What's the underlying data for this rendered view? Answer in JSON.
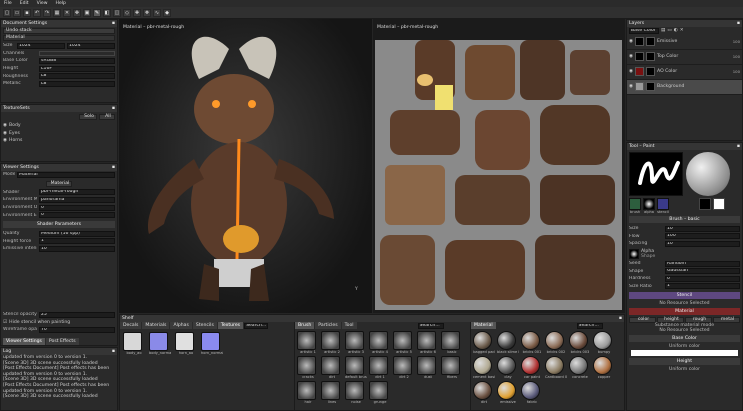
{
  "menu": [
    "File",
    "Edit",
    "View",
    "Help"
  ],
  "document_settings": {
    "title": "Document Settings",
    "undo_stack": "Undo stack",
    "section_material": "Material",
    "size_label": "Size",
    "size_value": "1024",
    "size_value2": "1024",
    "channels_label": "Channels",
    "rows": [
      {
        "label": "Base Color",
        "value": "sRGB8"
      },
      {
        "label": "Height",
        "value": "L16F"
      },
      {
        "label": "Roughness",
        "value": "L8"
      },
      {
        "label": "Metallic",
        "value": "L8"
      }
    ]
  },
  "texture_sets": {
    "title": "TextureSets",
    "solo": "Solo",
    "all": "All",
    "items": [
      "Body",
      "Eyes",
      "Horns"
    ]
  },
  "viewer_settings": {
    "title": "Viewer Settings",
    "mode_label": "Mode",
    "mode_value": "Material",
    "mode_button": "Material",
    "shader_label": "Shader",
    "shader_value": "pbr-metal-rough",
    "env_map_label": "Environment Map",
    "env_map_value": "panorama",
    "env_opacity_label": "Environment Opacity",
    "env_opacity_value": "0",
    "env_exposure_label": "Environment Exposure (EV)",
    "env_exposure_value": "0",
    "shader_params": "Shader Parameters",
    "quality_label": "Quality",
    "quality_value": "Medium (16 spp)",
    "height_force_label": "Height force",
    "height_force_value": "1",
    "emissive_label": "Emissive intensity",
    "emissive_value": "10",
    "stencil_label": "Stencil opacity",
    "stencil_value": "25",
    "hide_stencil": "Hide stencil when painting",
    "wireframe_label": "Wireframe opacity",
    "wireframe_value": "70",
    "tabs": [
      "Viewer Settings",
      "Post Effects"
    ]
  },
  "log": {
    "title": "Log",
    "lines": [
      "updated from version 0 to version 1.",
      "[Scene 3D] 3D scene successfully loaded",
      "[Post Effects Document] Post effects has been",
      "updated from version 0 to version 1.",
      "[Scene 3D] 3D scene successfully loaded",
      "[Post Effects Document] Post effects has been",
      "updated from version 0 to version 1.",
      "[Scene 3D] 3D scene successfully loaded"
    ]
  },
  "viewport3d": {
    "label": "Material – pbr-metal-rough",
    "axis": "Y"
  },
  "viewport2d": {
    "label": "Material – pbr-metal-rough"
  },
  "shelf": {
    "title": "Shelf",
    "left_tabs": [
      "Decals",
      "Materials",
      "Alphas",
      "Stencils",
      "Textures"
    ],
    "left_search": "Search...",
    "left_items": [
      "body_ao",
      "body_normal",
      "horn_ao",
      "horn_normal"
    ],
    "mid_tabs": [
      "Brush",
      "Particles",
      "Tool"
    ],
    "mid_search": "Search...",
    "mid_items": [
      "artistic 1",
      "artistic 2",
      "artistic 3",
      "artistic 4",
      "artistic 5",
      "artistic 6",
      "basic",
      "cracks",
      "dirt",
      "default brush",
      "dirt 1",
      "dirt 2",
      "dust",
      "fibers",
      "hair",
      "lines",
      "noise",
      "grunge"
    ],
    "right_tab": "Material",
    "right_search": "Search...",
    "right_items": [
      "bagged pad",
      "black slime bell",
      "bricks 001",
      "bricks 002",
      "bricks 003",
      "bumpy",
      "cement basic",
      "clay",
      "car paint",
      "Cardboard 001",
      "concrete",
      "copper",
      "dirt",
      "emissive",
      "fabric"
    ]
  },
  "layers": {
    "title": "Layers",
    "channel": "Base Color",
    "items": [
      {
        "name": "Emissive",
        "opacity": "100"
      },
      {
        "name": "Top Color",
        "opacity": "100"
      },
      {
        "name": "AO Color",
        "opacity": "100"
      },
      {
        "name": "Background",
        "opacity": ""
      }
    ]
  },
  "tool_paint": {
    "title": "Tool – Paint",
    "thumb_labels": [
      "brush",
      "alpha",
      "stencil",
      "mat"
    ],
    "brush_header": "Brush – basic",
    "size_label": "Size",
    "size_value": "10",
    "flow_label": "Flow",
    "flow_value": "100",
    "spacing_label": "Spacing",
    "spacing_value": "10",
    "alpha_label": "Alpha",
    "alpha_value": "Shape",
    "seed_label": "Seed",
    "seed_value": "Random",
    "shape_label": "Shape",
    "shape_value": "Gaussian",
    "hardness_label": "Hardness",
    "hardness_value": "0",
    "ratio_label": "Size Ratio",
    "ratio_value": "1",
    "stencil_header": "Stencil",
    "stencil_none": "No Resource Selected",
    "material_header": "Material",
    "material_channels": [
      "color",
      "height",
      "rough",
      "metal"
    ],
    "mode_line": "Substance material mode",
    "material_none": "No Resource Selected",
    "base_color_header": "Base Color",
    "base_color_value": "Uniform color",
    "height_header": "Height",
    "height_value": "Uniform color"
  },
  "colors": {
    "accent_purple": "#5e4880",
    "accent_red": "#7c2727",
    "uv_background": "#8a8a8a"
  }
}
